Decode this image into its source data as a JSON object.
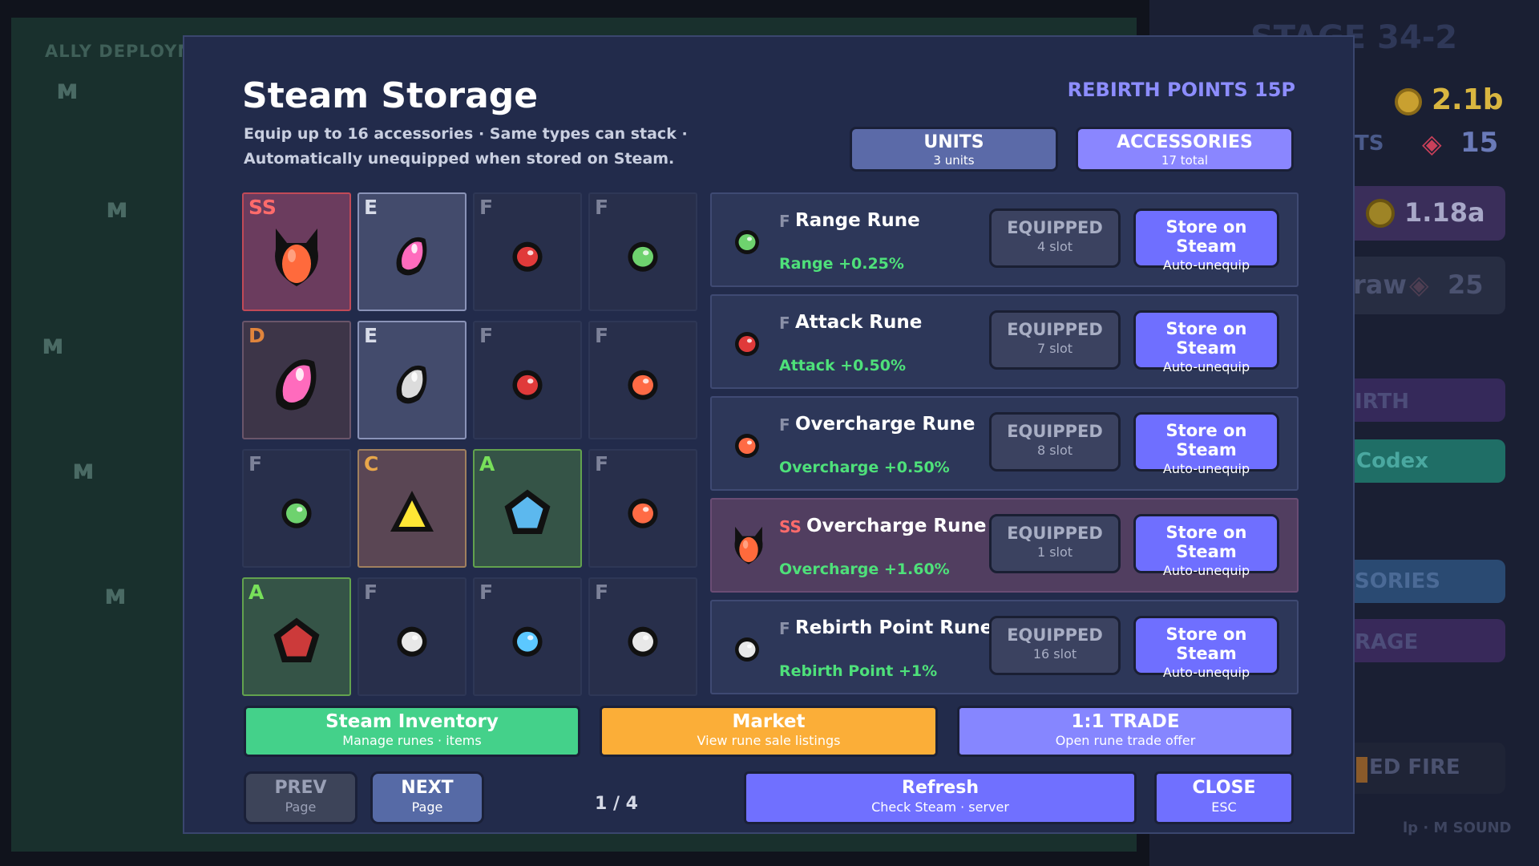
{
  "background": {
    "ally_label": "ALLY DEPLOYM",
    "stage": "STAGE 34-2",
    "gold": "2.1b",
    "gems": "15",
    "gems_label": "TS",
    "income": "1.18a",
    "draw_label": "raw",
    "draw_cost": "25",
    "menu": [
      "IRTH",
      "Codex",
      "SORIES",
      "RAGE",
      "ED FIRE"
    ],
    "hint": "lp · M SOUND"
  },
  "modal": {
    "title": "Steam Storage",
    "subtitle": "Equip up to 16 accessories · Same types can stack · Automatically unequipped when stored on Steam.",
    "rebirth_points": "REBIRTH POINTS 15P",
    "tabs": {
      "units": {
        "label": "UNITS",
        "sub": "3 units"
      },
      "accessories": {
        "label": "ACCESSORIES",
        "sub": "17 total"
      }
    }
  },
  "grid": [
    {
      "grade": "SS",
      "gem": "ss-horned",
      "grade_color": "#ff6b6b"
    },
    {
      "grade": "E",
      "gem": "pink-large",
      "grade_color": "#d7dbe8"
    },
    {
      "grade": "F",
      "gem": "red",
      "grade_color": "#7d8299"
    },
    {
      "grade": "F",
      "gem": "green",
      "grade_color": "#7d8299"
    },
    {
      "grade": "D",
      "gem": "pink-xl",
      "grade_color": "#e0843c"
    },
    {
      "grade": "E",
      "gem": "white-large",
      "grade_color": "#d7dbe8"
    },
    {
      "grade": "F",
      "gem": "red",
      "grade_color": "#7d8299"
    },
    {
      "grade": "F",
      "gem": "orange",
      "grade_color": "#7d8299"
    },
    {
      "grade": "F",
      "gem": "green",
      "grade_color": "#7d8299"
    },
    {
      "grade": "C",
      "gem": "yellow-triangle",
      "grade_color": "#e8a64a"
    },
    {
      "grade": "A",
      "gem": "blue-pentagon",
      "grade_color": "#78e05a"
    },
    {
      "grade": "F",
      "gem": "orange",
      "grade_color": "#7d8299"
    },
    {
      "grade": "A",
      "gem": "red-pentagon",
      "grade_color": "#78e05a"
    },
    {
      "grade": "F",
      "gem": "white",
      "grade_color": "#7d8299"
    },
    {
      "grade": "F",
      "gem": "blue",
      "grade_color": "#7d8299"
    },
    {
      "grade": "F",
      "gem": "white",
      "grade_color": "#7d8299"
    }
  ],
  "runes": [
    {
      "grade": "F",
      "name": "Range Rune",
      "stat": "Range +0.25%",
      "equip": "EQUIPPED",
      "slot": "4 slot",
      "store": "Store on Steam",
      "store_sub": "Auto-unequip",
      "gem": "green"
    },
    {
      "grade": "F",
      "name": "Attack Rune",
      "stat": "Attack +0.50%",
      "equip": "EQUIPPED",
      "slot": "7 slot",
      "store": "Store on Steam",
      "store_sub": "Auto-unequip",
      "gem": "red"
    },
    {
      "grade": "F",
      "name": "Overcharge Rune",
      "stat": "Overcharge +0.50%",
      "equip": "EQUIPPED",
      "slot": "8 slot",
      "store": "Store on Steam",
      "store_sub": "Auto-unequip",
      "gem": "orange"
    },
    {
      "grade": "SS",
      "name": "Overcharge Rune",
      "stat": "Overcharge +1.60%",
      "equip": "EQUIPPED",
      "slot": "1 slot",
      "store": "Store on Steam",
      "store_sub": "Auto-unequip",
      "gem": "ss-horned"
    },
    {
      "grade": "F",
      "name": "Rebirth Point Rune",
      "stat": "Rebirth Point +1%",
      "equip": "EQUIPPED",
      "slot": "16 slot",
      "store": "Store on Steam",
      "store_sub": "Auto-unequip",
      "gem": "white"
    }
  ],
  "actions": {
    "inventory": {
      "label": "Steam Inventory",
      "sub": "Manage runes · items"
    },
    "market": {
      "label": "Market",
      "sub": "View rune sale listings"
    },
    "trade": {
      "label": "1:1 TRADE",
      "sub": "Open rune trade offer"
    }
  },
  "nav": {
    "prev": {
      "label": "PREV",
      "sub": "Page"
    },
    "next": {
      "label": "NEXT",
      "sub": "Page"
    },
    "page": "1 / 4",
    "refresh": {
      "label": "Refresh",
      "sub": "Check Steam · server"
    },
    "close": {
      "label": "CLOSE",
      "sub": "ESC"
    }
  },
  "colors": {
    "accent": "#7070ff",
    "stat_green": "#4ee07a",
    "ss_red": "#ff6b6b"
  }
}
